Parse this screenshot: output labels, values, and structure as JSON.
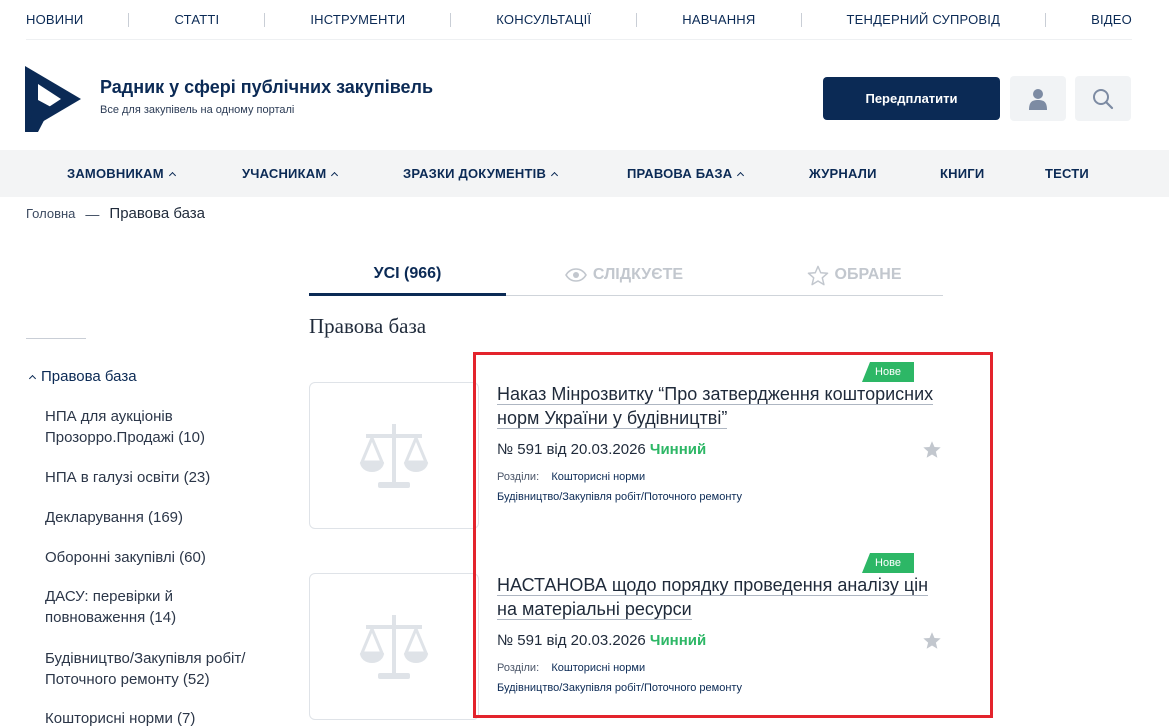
{
  "topnav": {
    "items": [
      "НОВИНИ",
      "СТАТТІ",
      "ІНСТРУМЕНТИ",
      "КОНСУЛЬТАЦІЇ",
      "НАВЧАННЯ",
      "ТЕНДЕРНИЙ СУПРОВІД",
      "ВІДЕО"
    ]
  },
  "header": {
    "title": "Радник у сфері публічних закупівель",
    "subtitle": "Все для закупівель на одному порталі",
    "subscribe_label": "Передплатити",
    "brand_color": "#0b2a55"
  },
  "mainnav": {
    "items": [
      {
        "label": "ЗАМОВНИКАМ",
        "dropdown": true
      },
      {
        "label": "УЧАСНИКАМ",
        "dropdown": true
      },
      {
        "label": "ЗРАЗКИ ДОКУМЕНТІВ",
        "dropdown": true
      },
      {
        "label": "ПРАВОВА БАЗА",
        "dropdown": true
      },
      {
        "label": "ЖУРНАЛИ",
        "dropdown": false
      },
      {
        "label": "КНИГИ",
        "dropdown": false
      },
      {
        "label": "ТЕСТИ",
        "dropdown": false
      }
    ]
  },
  "breadcrumb": {
    "home": "Головна",
    "separator": "—",
    "current": "Правова база"
  },
  "tabs": {
    "all": "УСІ (966)",
    "following": "СЛІДКУЄТЕ",
    "favorites": "ОБРАНЕ"
  },
  "section_title": "Правова база",
  "sidebar": {
    "root": "Правова база",
    "items": [
      "НПА для аукціонів Прозорро.Продажі (10)",
      "НПА в галузі освіти (23)",
      "Декларування (169)",
      "Оборонні закупівлі (60)",
      "ДАСУ: перевірки й повноваження (14)",
      "Будівництво/Закупівля робіт/ Поточного ремонту (52)",
      "Кошторисні норми (7)"
    ]
  },
  "documents": [
    {
      "badge": "Нове",
      "title": "Наказ Мінрозвитку “Про затвердження кошторисних норм України у будівництві”",
      "number": "№ 591 від 20.03.2026",
      "status": "Чинний",
      "sections_label": "Розділи:",
      "tag1": "Кошторисні норми",
      "tag2": "Будівництво/Закупівля робіт/Поточного ремонту"
    },
    {
      "badge": "Нове",
      "title": "НАСТАНОВА щодо порядку проведення аналізу цін на матеріальні ресурси",
      "number": "№ 591 від 20.03.2026",
      "status": "Чинний",
      "sections_label": "Розділи:",
      "tag1": "Кошторисні норми",
      "tag2": "Будівництво/Закупівля робіт/Поточного ремонту"
    }
  ],
  "colors": {
    "status_active": "#2db766",
    "highlight": "#e3232c"
  }
}
